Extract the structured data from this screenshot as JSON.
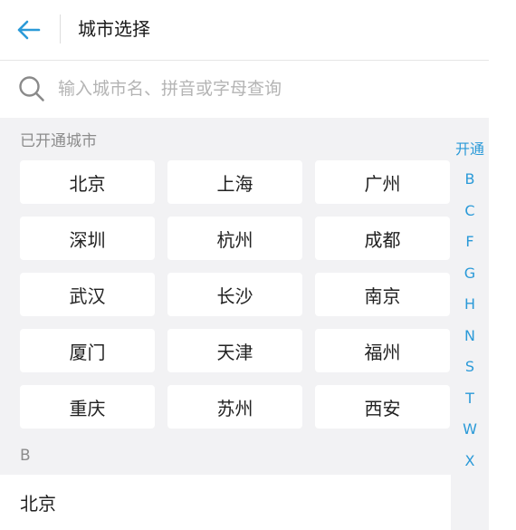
{
  "header": {
    "title": "城市选择"
  },
  "search": {
    "placeholder": "输入城市名、拼音或字母查询"
  },
  "sections": {
    "open_label": "已开通城市",
    "b_label": "B"
  },
  "cities": [
    "北京",
    "上海",
    "广州",
    "深圳",
    "杭州",
    "成都",
    "武汉",
    "长沙",
    "南京",
    "厦门",
    "天津",
    "福州",
    "重庆",
    "苏州",
    "西安"
  ],
  "index": [
    "开通",
    "B",
    "C",
    "F",
    "G",
    "H",
    "N",
    "S",
    "T",
    "W",
    "X"
  ],
  "list": {
    "b_first": "北京"
  },
  "colors": {
    "accent": "#2b9ad8",
    "background": "#f2f2f4"
  },
  "icons": {
    "back": "back-arrow-icon",
    "search": "search-icon"
  }
}
